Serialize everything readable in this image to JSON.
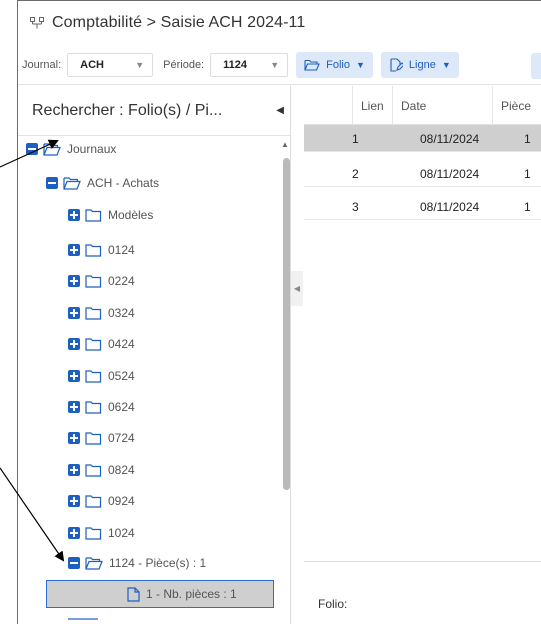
{
  "window": {
    "title": "Comptabilité > Saisie ACH 2024-11"
  },
  "toolbar": {
    "journal_label": "Journal:",
    "journal_value": "ACH",
    "periode_label": "Période:",
    "periode_value": "1124",
    "folio_button": "Folio",
    "ligne_button": "Ligne"
  },
  "left_panel": {
    "search_title": "Rechercher : Folio(s) / Pi..."
  },
  "tree": {
    "root": "Journaux",
    "journal": "ACH - Achats",
    "models": "Modèles",
    "periods": [
      "0124",
      "0224",
      "0324",
      "0424",
      "0524",
      "0624",
      "0724",
      "0824",
      "0924",
      "1024"
    ],
    "open_period": "1124 - Pièce(s) : 1",
    "selected_item": "1 - Nb. pièces : 1"
  },
  "grid": {
    "columns": [
      "Lien",
      "Date",
      "Pièce"
    ],
    "rows": [
      {
        "num": "1",
        "lien": "",
        "date": "08/11/2024",
        "piece": "1"
      },
      {
        "num": "2",
        "lien": "",
        "date": "08/11/2024",
        "piece": "1"
      },
      {
        "num": "3",
        "lien": "",
        "date": "08/11/2024",
        "piece": "1"
      }
    ],
    "folio_label": "Folio:"
  },
  "colors": {
    "accent": "#1e5fc2",
    "button_bg": "#dde8f8",
    "selection": "#cfcfcf",
    "selection_border": "#2b6fd6"
  },
  "icons": [
    "network-icon",
    "folder-open-icon",
    "folder-icon",
    "file-icon",
    "expand-icon",
    "collapse-icon",
    "caret-down-icon",
    "caret-left-icon",
    "arrow-icon"
  ]
}
